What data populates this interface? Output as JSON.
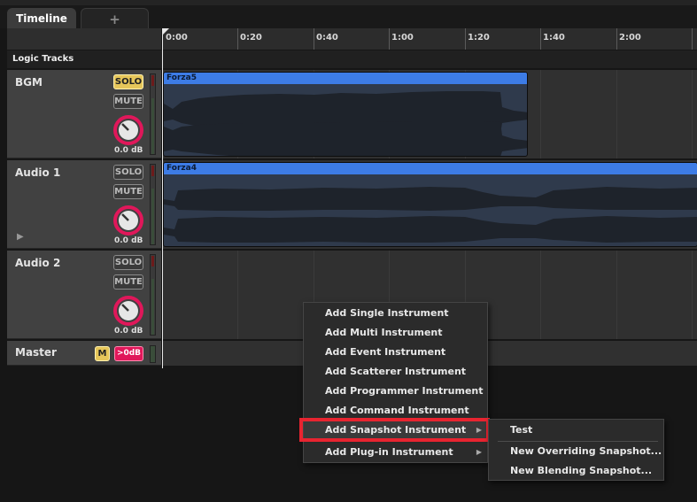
{
  "tabs": {
    "active_label": "Timeline",
    "add_label": "+"
  },
  "ruler": {
    "labels": [
      "0:00",
      "0:20",
      "0:40",
      "1:00",
      "1:20",
      "1:40",
      "2:00"
    ]
  },
  "section_label": "Logic Tracks",
  "tracks": [
    {
      "name": "BGM",
      "solo": "SOLO",
      "mute": "MUTE",
      "volume": "0.0 dB",
      "solo_active": true,
      "clip_label": "Forza5"
    },
    {
      "name": "Audio 1",
      "solo": "SOLO",
      "mute": "MUTE",
      "volume": "0.0 dB",
      "solo_active": false,
      "clip_label": "Forza4"
    },
    {
      "name": "Audio 2",
      "solo": "SOLO",
      "mute": "MUTE",
      "volume": "0.0 dB",
      "solo_active": false
    }
  ],
  "master": {
    "name": "Master",
    "mute_label": "M",
    "volume_label": ">0dB"
  },
  "context_menu": {
    "items": [
      "Add Single Instrument",
      "Add Multi Instrument",
      "Add Event Instrument",
      "Add Scatterer Instrument",
      "Add Programmer Instrument",
      "Add Command Instrument",
      "Add Snapshot Instrument",
      "Add Plug-in Instrument"
    ],
    "highlighted_item": "Add Snapshot Instrument"
  },
  "snapshot_submenu": {
    "items": [
      "Test",
      "New Overriding Snapshot...",
      "New Blending Snapshot..."
    ]
  },
  "colors": {
    "clip_header": "#3d7ce6",
    "solo_active": "#e6c65a",
    "knob_ring": "#e0175a",
    "highlight_box": "#e82430"
  }
}
